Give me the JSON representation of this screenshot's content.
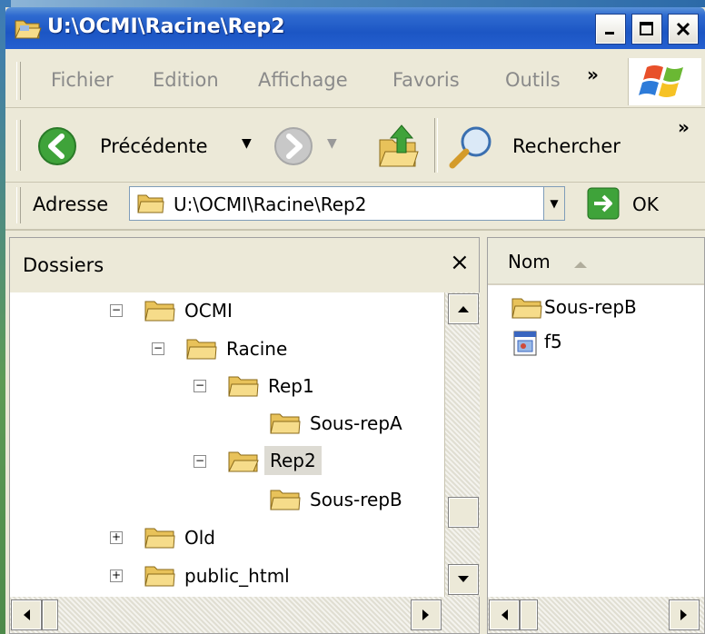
{
  "window": {
    "title": "U:\\OCMI\\Racine\\Rep2"
  },
  "menu": {
    "items": [
      "Fichier",
      "Edition",
      "Affichage",
      "Favoris",
      "Outils"
    ],
    "more": "»"
  },
  "toolbar": {
    "back_label": "Précédente",
    "search_label": "Rechercher",
    "more": "»"
  },
  "address": {
    "label": "Adresse",
    "value": "U:\\OCMI\\Racine\\Rep2",
    "go_label": "OK"
  },
  "folders_pane": {
    "title": "Dossiers",
    "close": "×",
    "tree": [
      {
        "label": "OCMI",
        "expander": "−",
        "selected": false
      },
      {
        "label": "Racine",
        "expander": "−",
        "selected": false
      },
      {
        "label": "Rep1",
        "expander": "−",
        "selected": false
      },
      {
        "label": "Sous-repA",
        "expander": "",
        "selected": false
      },
      {
        "label": "Rep2",
        "expander": "−",
        "selected": true
      },
      {
        "label": "Sous-repB",
        "expander": "",
        "selected": false
      },
      {
        "label": "Old",
        "expander": "+",
        "selected": false
      },
      {
        "label": "public_html",
        "expander": "+",
        "selected": false
      }
    ]
  },
  "file_list": {
    "column_name": "Nom",
    "items": [
      {
        "name": "Sous-repB",
        "icon": "folder-icon"
      },
      {
        "name": "f5",
        "icon": "file-icon"
      }
    ]
  },
  "colors": {
    "titlebar": "#245fd0",
    "chrome": "#ece9d8",
    "selection": "#dddbd3",
    "back_green": "#3fa33a"
  }
}
